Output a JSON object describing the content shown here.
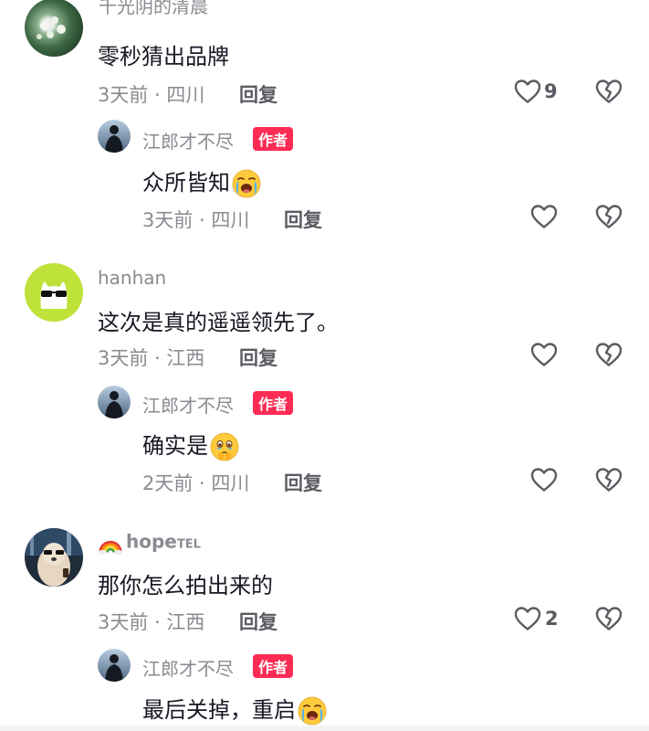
{
  "comments": [
    {
      "username": "千光阴的清晨",
      "content": "零秒猜出品牌",
      "time": "3天前",
      "location": "四川",
      "reply_label": "回复",
      "likes": "9"
    },
    {
      "username": "江郎才不尽",
      "badge": "作者",
      "content": "众所皆知",
      "emoji": "loudly-crying-face",
      "time": "3天前",
      "location": "四川",
      "reply_label": "回复"
    },
    {
      "username": "hanhan",
      "content": "这次是真的遥遥领先了。",
      "time": "3天前",
      "location": "江西",
      "reply_label": "回复"
    },
    {
      "username": "江郎才不尽",
      "badge": "作者",
      "content": "确实是",
      "emoji": "face-holding-back-tears",
      "time": "2天前",
      "location": "四川",
      "reply_label": "回复"
    },
    {
      "username": "hope",
      "username_suffix": "TEL",
      "username_emoji": "rainbow",
      "content": "那你怎么拍出来的",
      "time": "3天前",
      "location": "江西",
      "reply_label": "回复",
      "likes": "2"
    },
    {
      "username": "江郎才不尽",
      "badge": "作者",
      "content": "最后关掉，重启",
      "emoji": "loudly-crying-face"
    }
  ],
  "separator": " · ",
  "icons": {
    "like": "heart-outline-icon",
    "dislike": "broken-heart-outline-icon"
  },
  "colors": {
    "author_badge": "#fe2c55",
    "meta_text": "#8a8b91",
    "main_text": "#161823"
  }
}
